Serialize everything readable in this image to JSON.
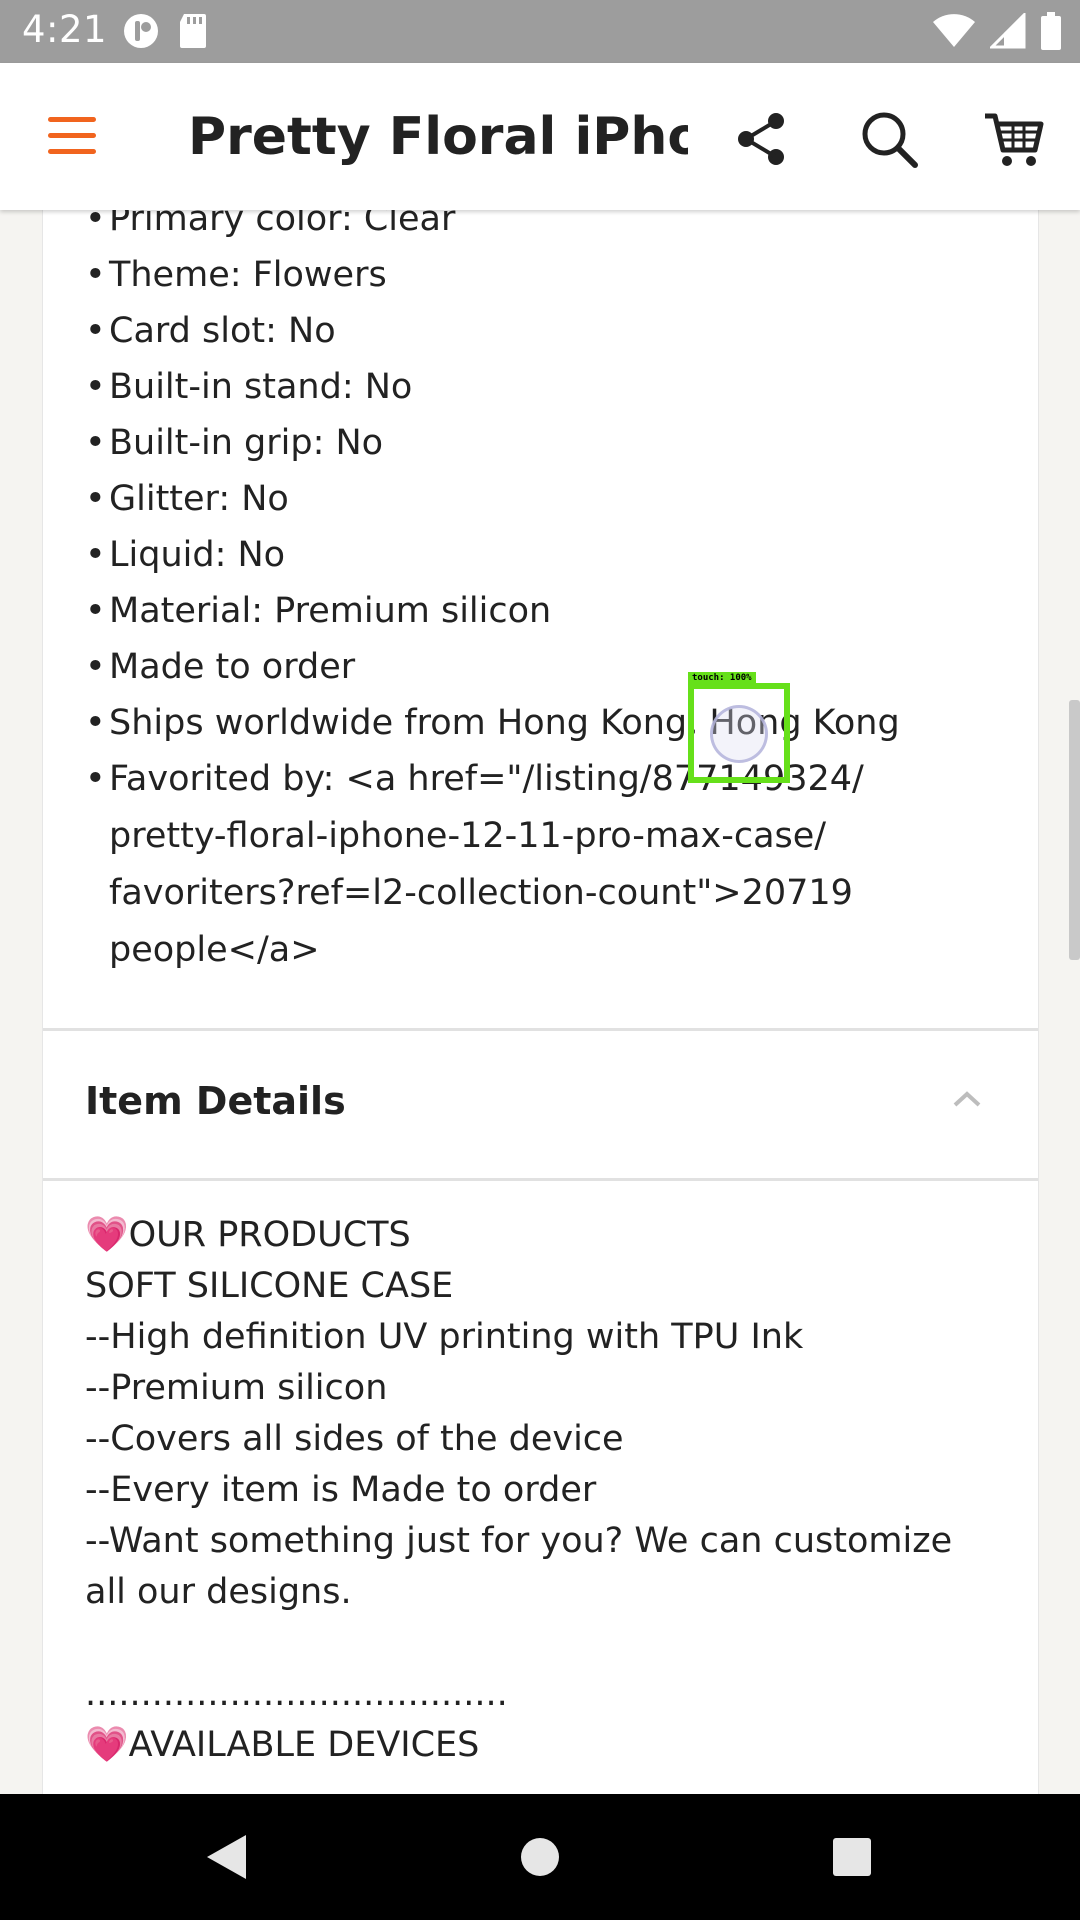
{
  "status_bar": {
    "time": "4:21"
  },
  "app_bar": {
    "title": "Pretty Floral iPho…",
    "accent_color": "#f1641e",
    "icons": [
      "menu-icon",
      "share-icon",
      "search-icon",
      "cart-icon"
    ]
  },
  "highlights": {
    "items": [
      "Primary color: Clear",
      "Theme: Flowers",
      "Card slot: No",
      "Built-in stand: No",
      "Built-in grip: No",
      "Glitter: No",
      "Liquid: No",
      "Material: Premium silicon",
      "Made to order",
      "Ships worldwide from Hong Kong, Hong Kong",
      "Favorited by: <a href=\"/listing/877149324/ pretty-floral-iphone-12-11-pro-max-case/ favoriters?ref=l2-collection-count\">20719 people</a>"
    ]
  },
  "item_details": {
    "title": "Item Details",
    "description": "💗OUR PRODUCTS\nSOFT SILICONE CASE\n--High definition UV printing with TPU Ink\n--Premium silicon\n--Covers all sides of the device\n--Every item is Made to order\n--Want something just for you? We can customize all our designs.\n\n......................................\n💗AVAILABLE DEVICES"
  },
  "touch_overlay": {
    "label": "touch: 100%"
  }
}
